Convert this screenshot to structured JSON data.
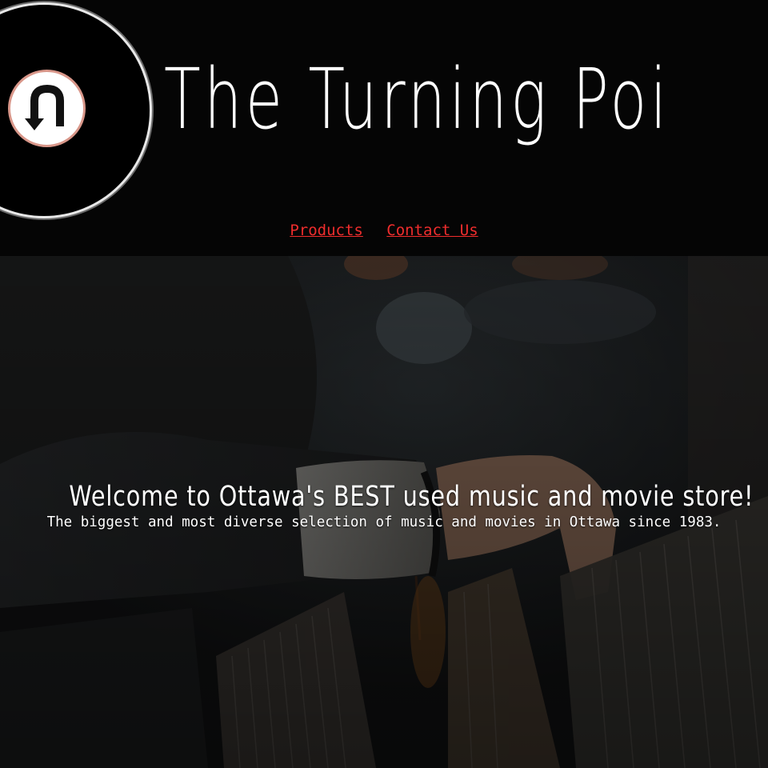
{
  "header": {
    "title": "The Turning Poi",
    "logo_icon": "u-turn-arrow-icon"
  },
  "nav": {
    "items": [
      {
        "label": "Products"
      },
      {
        "label": "Contact Us"
      }
    ],
    "link_color": "#f02d2d"
  },
  "hero": {
    "heading": "Welcome to Ottawa's BEST used music and movie store!",
    "subheading": "The biggest and most diverse selection of music and movies in Ottawa since 1983.",
    "background": "record-crates-photo"
  },
  "colors": {
    "header_bg": "#050505",
    "text": "#ffffff",
    "logo_ring": "#e8e8e8",
    "logo_badge_border": "#d9978a"
  }
}
